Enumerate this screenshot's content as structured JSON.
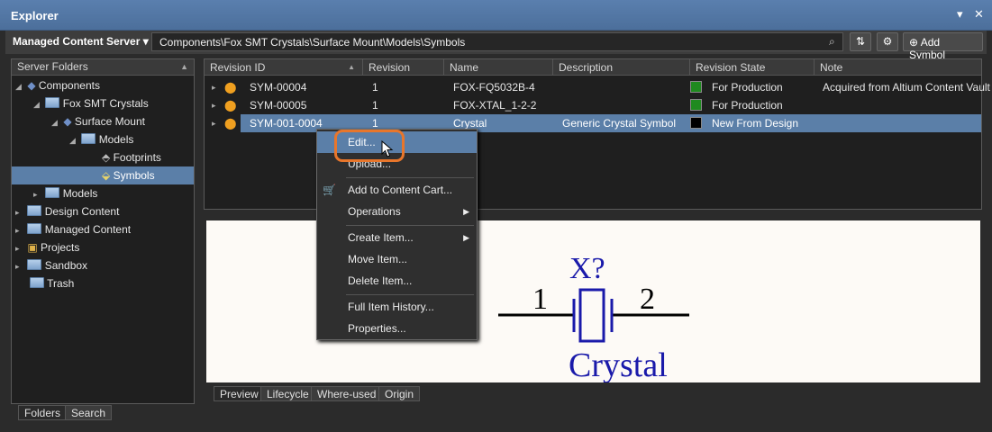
{
  "window": {
    "title": "Explorer",
    "buttons": [
      "▾",
      "✕"
    ]
  },
  "toolbar": {
    "server": "Managed Content Server",
    "path": "Components\\Fox SMT Crystals\\Surface Mount\\Models\\Symbols",
    "add_label": "Add Symbol",
    "icons": [
      "search-icon",
      "refresh-icon",
      "gear-icon",
      "add-icon"
    ]
  },
  "folders": {
    "header": "Server Folders",
    "items": [
      "Components",
      "Fox SMT Crystals",
      "Surface Mount",
      "Models",
      "Footprints",
      "Symbols",
      "Models",
      "Design Content",
      "Managed Content",
      "Projects",
      "Sandbox",
      "Trash"
    ],
    "tabs": [
      "Folders",
      "Search"
    ]
  },
  "grid": {
    "columns": [
      "Revision ID",
      "Revision",
      "Name",
      "Description",
      "Revision State",
      "Note"
    ],
    "rows": [
      {
        "id": "SYM-00004",
        "revision": "1",
        "name": "FOX-FQ5032B-4",
        "description": "",
        "state": "For Production",
        "state_color": "#1f8a1f",
        "note": "Acquired from Altium Content Vault"
      },
      {
        "id": "SYM-00005",
        "revision": "1",
        "name": "FOX-XTAL_1-2-2",
        "description": "",
        "state": "For Production",
        "state_color": "#1f8a1f",
        "note": ""
      },
      {
        "id": "SYM-001-0004",
        "revision": "1",
        "name": "Crystal",
        "description": "Generic Crystal Symbol",
        "state": "New From Design",
        "state_color": "#000000",
        "note": ""
      }
    ]
  },
  "menu": {
    "items": [
      "Edit...",
      "Upload...",
      "Add to Content Cart...",
      "Operations",
      "Create Item...",
      "Move Item...",
      "Delete Item...",
      "Full Item History...",
      "Properties..."
    ]
  },
  "preview": {
    "designator": "X?",
    "pin1": "1",
    "pin2": "2",
    "comment": "Crystal"
  },
  "bottom_tabs": [
    "Preview",
    "Lifecycle",
    "Where-used",
    "Origin"
  ],
  "colors": {
    "selection": "#5b7fa8",
    "highlight": "#e8762b",
    "accent": "#4c6f9b"
  }
}
